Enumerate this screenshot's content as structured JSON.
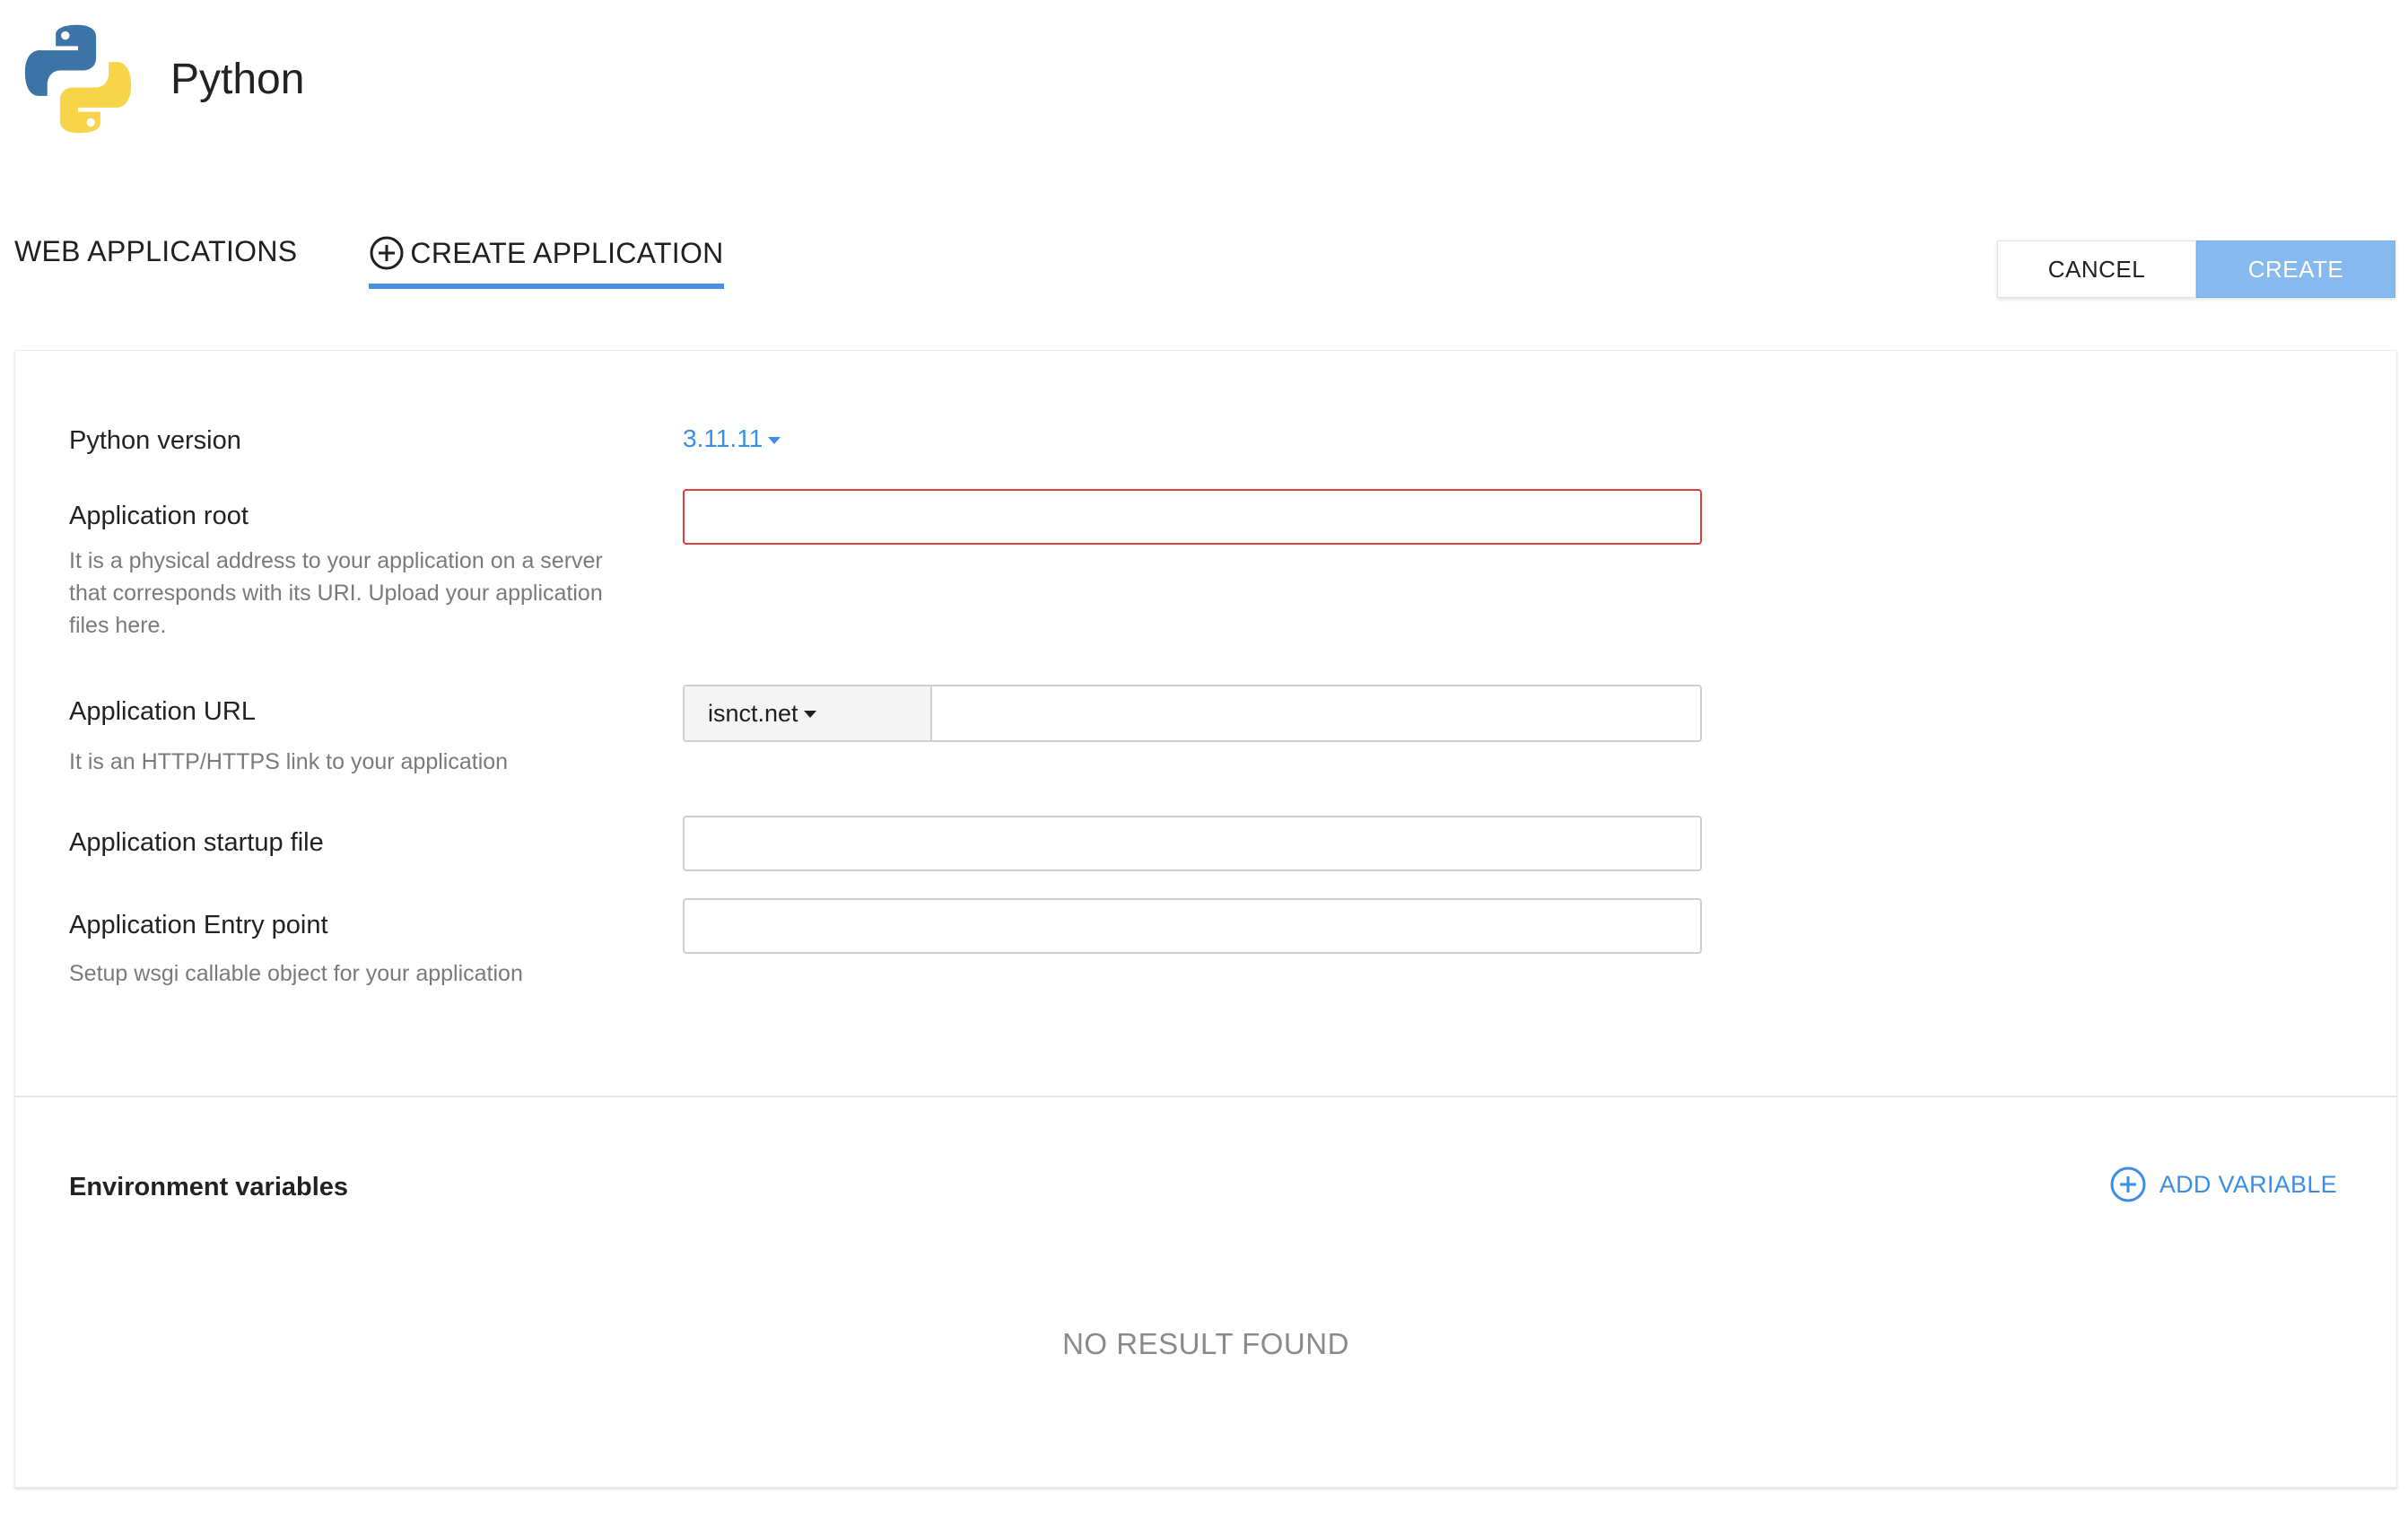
{
  "header": {
    "logo_icon": "python-logo-icon",
    "title": "Python"
  },
  "tabs": [
    {
      "label": "WEB APPLICATIONS",
      "active": false
    },
    {
      "label": "CREATE APPLICATION",
      "active": true,
      "icon": "plus-circle-icon"
    }
  ],
  "toolbar": {
    "cancel_label": "CANCEL",
    "create_label": "CREATE"
  },
  "form": {
    "python_version": {
      "label": "Python version",
      "value": "3.11.11"
    },
    "app_root": {
      "label": "Application root",
      "hint": "It is a physical address to your application on a server that corresponds with its URI. Upload your application files here.",
      "value": "",
      "state": "error"
    },
    "app_url": {
      "label": "Application URL",
      "hint": "It is an HTTP/HTTPS link to your application",
      "domain": "isnct.net",
      "path_value": ""
    },
    "startup_file": {
      "label": "Application startup file",
      "value": ""
    },
    "entry_point": {
      "label": "Application Entry point",
      "hint": "Setup wsgi callable object for your application",
      "value": ""
    }
  },
  "env": {
    "title": "Environment variables",
    "add_label": "ADD VARIABLE",
    "empty_text": "NO RESULT FOUND"
  },
  "colors": {
    "accent": "#4a90e2",
    "link": "#3a8ee6",
    "create_button": "#86b9ee",
    "error_border": "#e0403a"
  }
}
